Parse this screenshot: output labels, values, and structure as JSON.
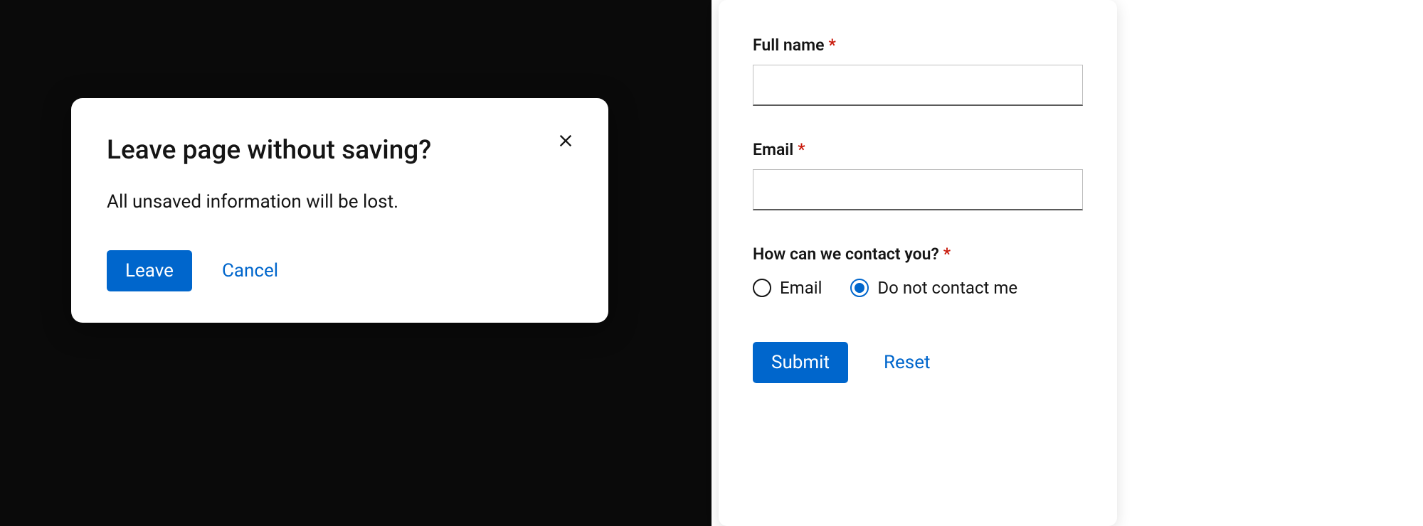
{
  "modal": {
    "title": "Leave page without saving?",
    "body": "All unsaved information will be lost.",
    "primary_label": "Leave",
    "secondary_label": "Cancel"
  },
  "form": {
    "fullname_label": "Full name",
    "fullname_value": "",
    "email_label": "Email",
    "email_value": "",
    "contact_label": "How can we contact you?",
    "radio_options": [
      {
        "label": "Email",
        "checked": false
      },
      {
        "label": "Do not contact me",
        "checked": true
      }
    ],
    "submit_label": "Submit",
    "reset_label": "Reset"
  }
}
